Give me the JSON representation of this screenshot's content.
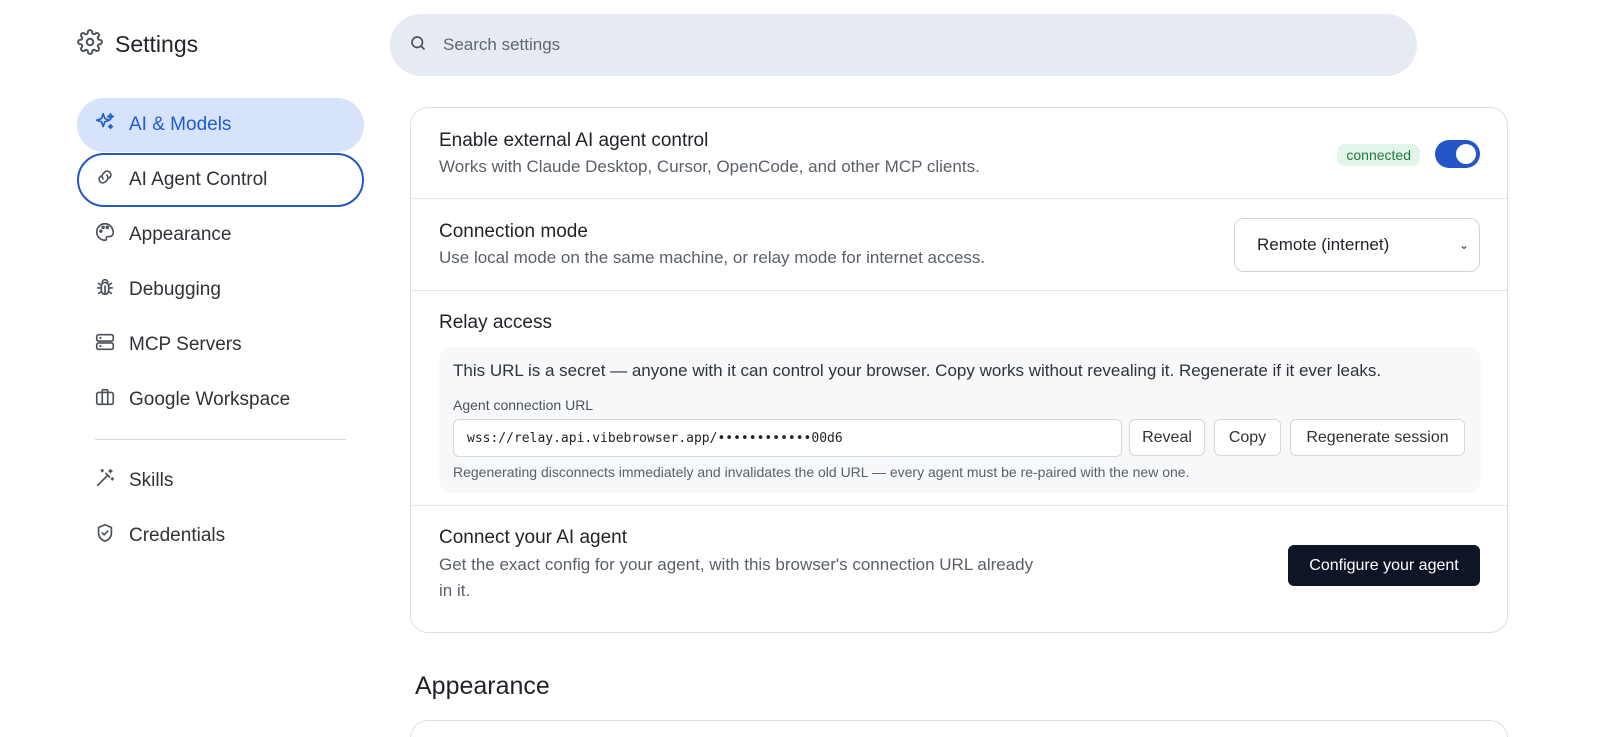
{
  "sidebar": {
    "title": "Settings",
    "items": [
      {
        "label": "AI & Models",
        "icon": "sparkles-icon"
      },
      {
        "label": "AI Agent Control",
        "icon": "link-icon"
      },
      {
        "label": "Appearance",
        "icon": "palette-icon"
      },
      {
        "label": "Debugging",
        "icon": "bug-icon"
      },
      {
        "label": "MCP Servers",
        "icon": "server-icon"
      },
      {
        "label": "Google Workspace",
        "icon": "briefcase-icon"
      },
      {
        "label": "Skills",
        "icon": "wand-icon"
      },
      {
        "label": "Credentials",
        "icon": "shield-check-icon"
      }
    ]
  },
  "search": {
    "placeholder": "Search settings"
  },
  "agent_control": {
    "enable": {
      "title": "Enable external AI agent control",
      "desc": "Works with Claude Desktop, Cursor, OpenCode, and other MCP clients.",
      "status": "connected",
      "toggle_on": true
    },
    "mode": {
      "title": "Connection mode",
      "desc": "Use local mode on the same machine, or relay mode for internet access.",
      "selected": "Remote (internet)"
    },
    "relay": {
      "title": "Relay access",
      "warning": "This URL is a secret — anyone with it can control your browser. Copy works without revealing it. Regenerate if it ever leaks.",
      "field_label": "Agent connection URL",
      "url": "wss://relay.api.vibebrowser.app/••••••••••••00d6",
      "reveal": "Reveal",
      "copy": "Copy",
      "regenerate": "Regenerate session",
      "note": "Regenerating disconnects immediately and invalidates the old URL — every agent must be re-paired with the new one."
    },
    "connect": {
      "title": "Connect your AI agent",
      "desc_line1": "Get the exact config for your agent, with this browser's connection URL already",
      "desc_line2": "in it.",
      "button": "Configure your agent"
    }
  },
  "next_section": {
    "title": "Appearance"
  },
  "colors": {
    "accent": "#2456c8",
    "active_bg": "#d6e3fa",
    "dark_button": "#0f1525",
    "badge_green": "#1f7a3d"
  }
}
